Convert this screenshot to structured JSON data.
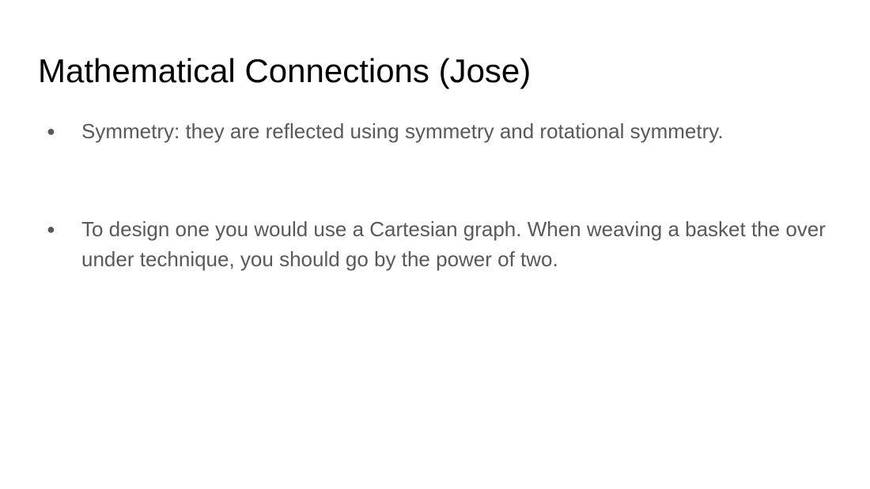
{
  "slide": {
    "title": "Mathematical Connections (Jose)",
    "bullets": [
      {
        "marker": "●",
        "text": "Symmetry: they are reflected using symmetry and rotational symmetry."
      },
      {
        "marker": "●",
        "text": "To design one you would use a Cartesian graph. When weaving a basket the over under technique, you should go by the power of two."
      }
    ]
  },
  "colors": {
    "title": "#000000",
    "body_text": "#595959",
    "background": "#ffffff"
  }
}
